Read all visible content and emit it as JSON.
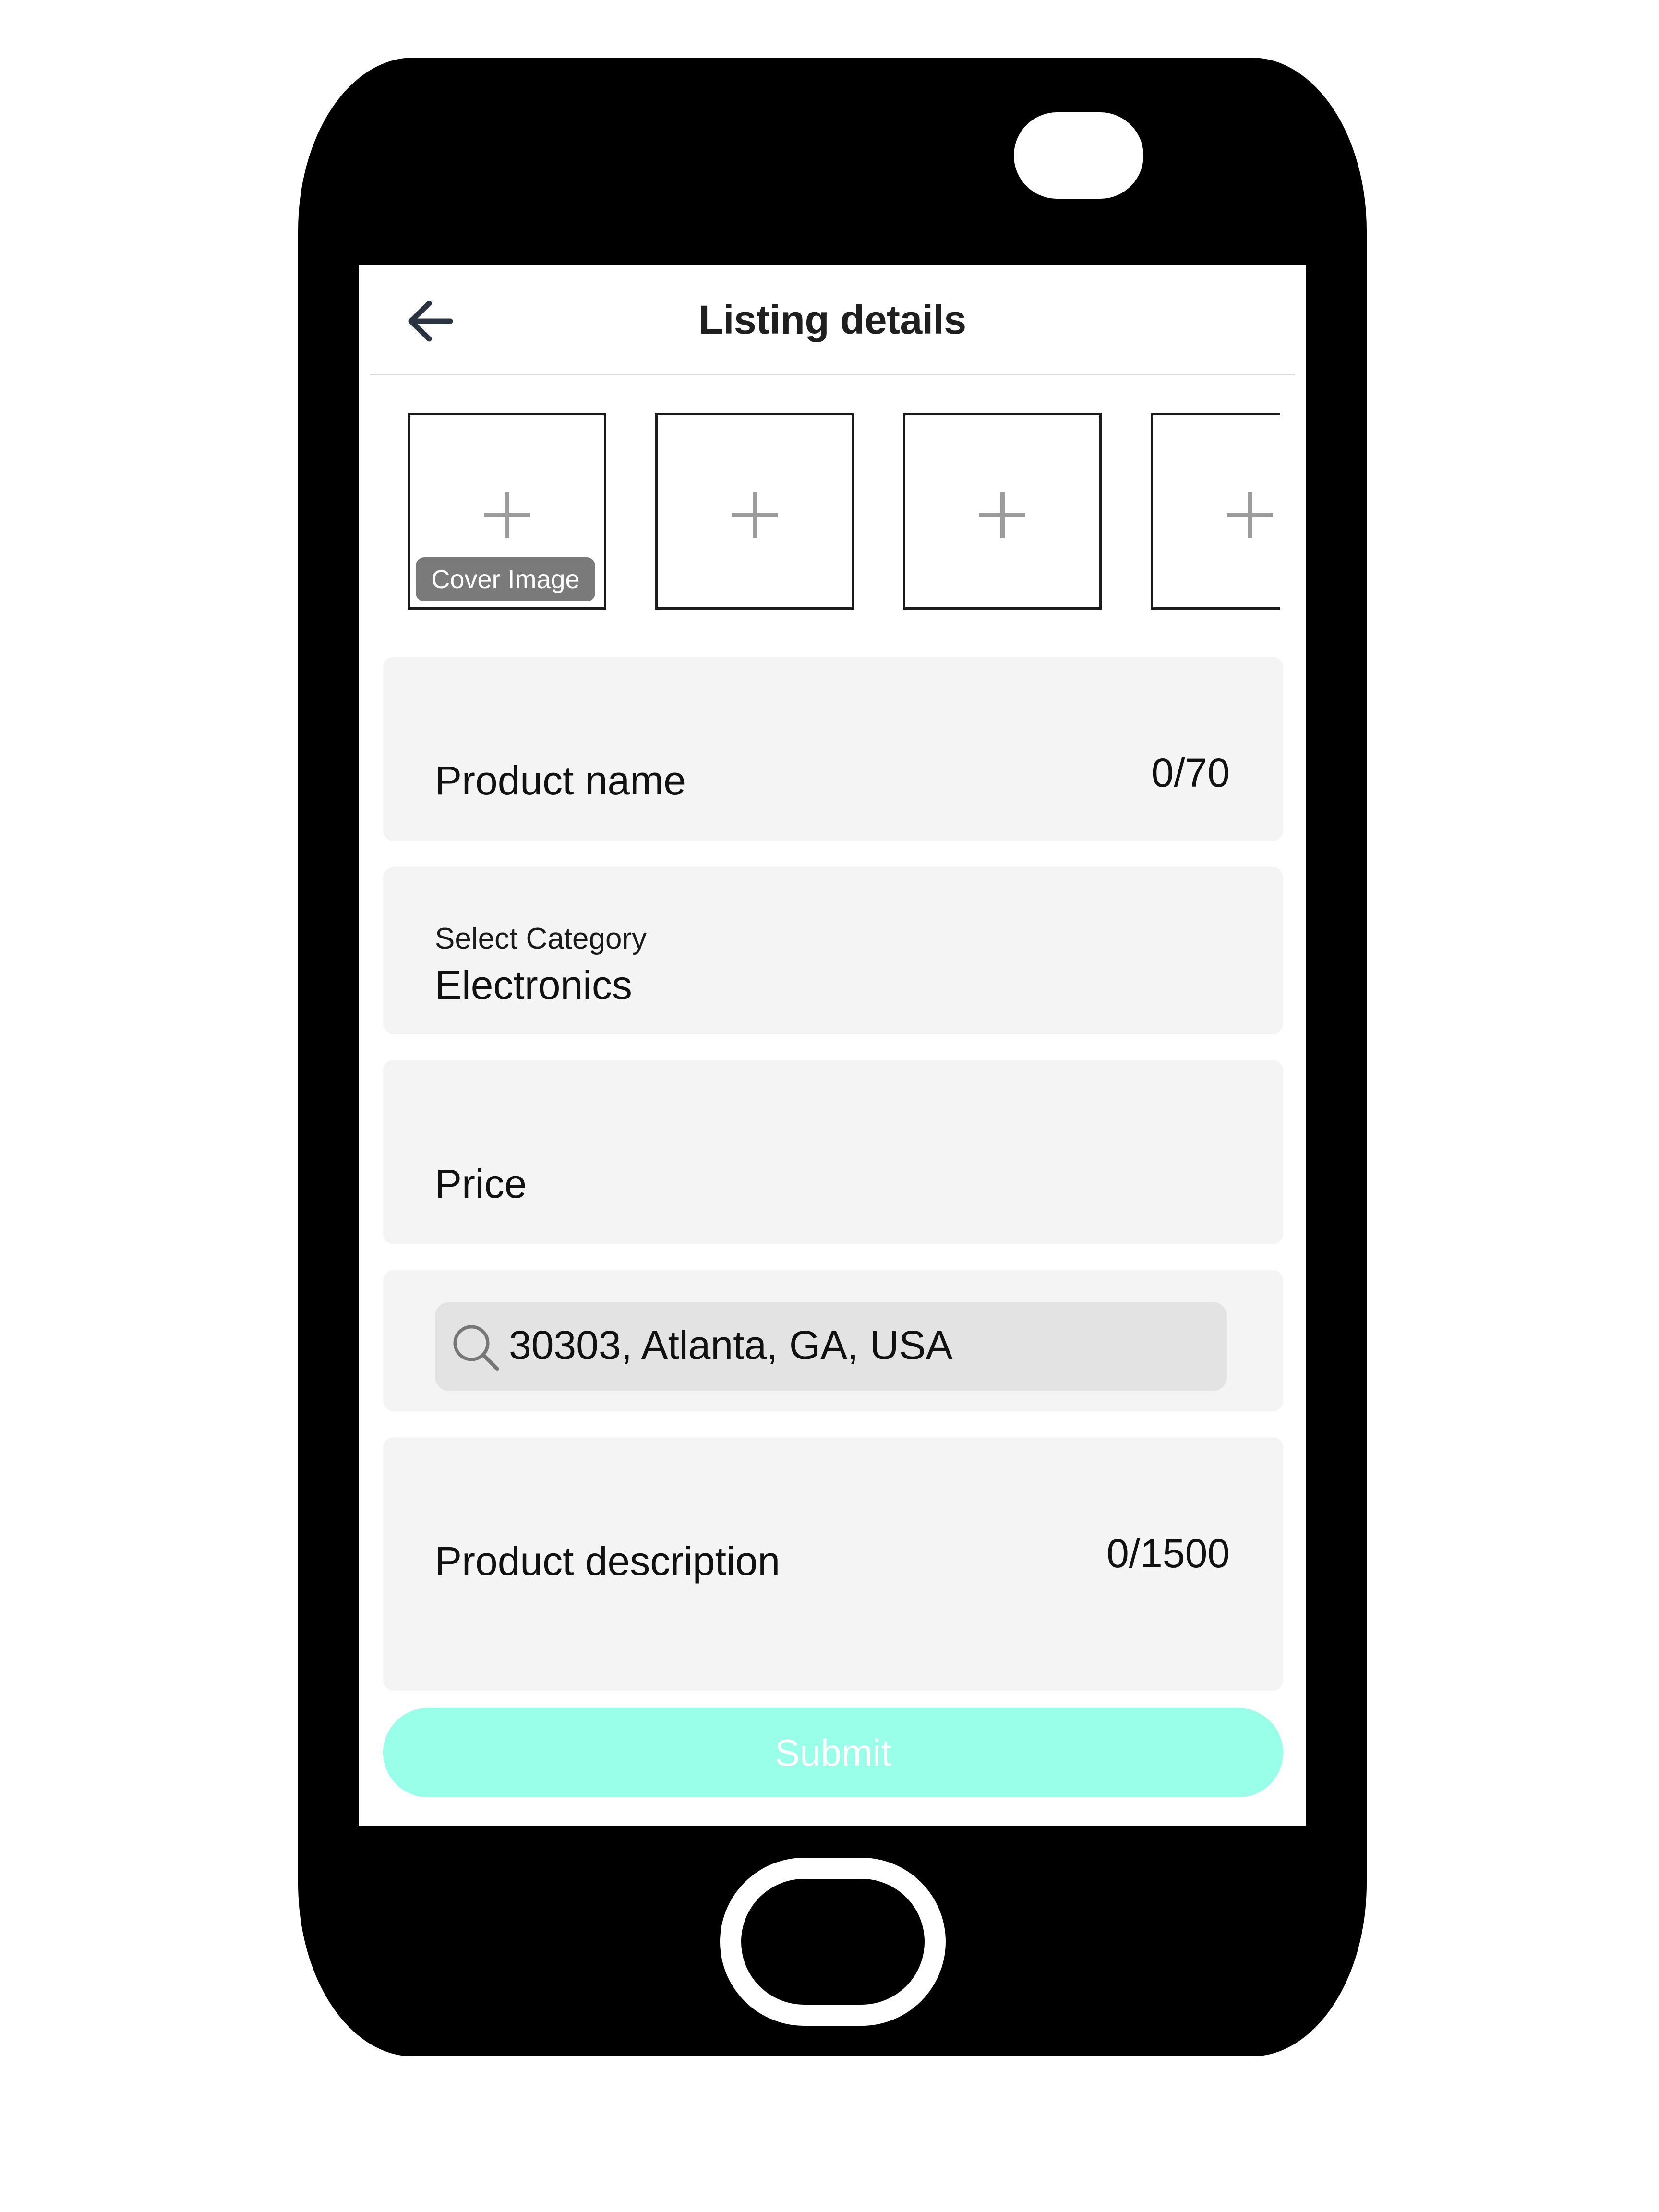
{
  "header": {
    "title": "Listing details",
    "back_icon": "arrow-left-icon"
  },
  "images": {
    "cover_label": "Cover Image",
    "slot_icon": "plus-icon",
    "slot_count_visible": 4
  },
  "form": {
    "product_name": {
      "label": "Product name",
      "counter": "0/70"
    },
    "category": {
      "label": "Select Category",
      "value": "Electronics"
    },
    "price": {
      "label": "Price"
    },
    "location": {
      "value": "30303, Atlanta, GA, USA",
      "icon": "search-icon"
    },
    "description": {
      "label": "Product description",
      "counter": "0/1500"
    },
    "submit_label": "Submit"
  },
  "colors": {
    "submit_button": "#99ffe9",
    "field_background": "#f4f4f4",
    "location_input_background": "#e3e3e3",
    "badge_background": "#7a7a7a",
    "phone_frame": "#000000"
  }
}
